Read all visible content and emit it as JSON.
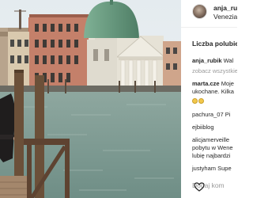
{
  "post": {
    "username": "anja_rubik",
    "location": "Venezia",
    "likes_label": "Liczba polubień",
    "comments": [
      {
        "user": "anja_rubik",
        "text": "Wal"
      },
      {
        "user": "",
        "text": "zobacz wszystkie"
      },
      {
        "user": "marta.cze",
        "text": "Moje"
      },
      {
        "user": "",
        "text": "ukochane. Kilka"
      },
      {
        "user": "",
        "text": "emoji"
      },
      {
        "user": "pachura_07",
        "text": "Pi"
      },
      {
        "user": "ejbiiblog",
        "text": ""
      },
      {
        "user": "alicjamerveille",
        "text": ""
      },
      {
        "user": "",
        "text": "pobytu w Wene"
      },
      {
        "user": "",
        "text": "lubię najbardzi"
      },
      {
        "user": "justyham",
        "text": "Supe"
      }
    ],
    "add_comment_placeholder": "Dodaj kom"
  },
  "icons": {
    "like": "heart-icon",
    "emoji": "emoji-icon"
  },
  "colors": {
    "text": "#262626",
    "muted": "#999999",
    "sky": "#e8eef0",
    "water": "#8aa59d",
    "dome": "#6d9a83"
  }
}
